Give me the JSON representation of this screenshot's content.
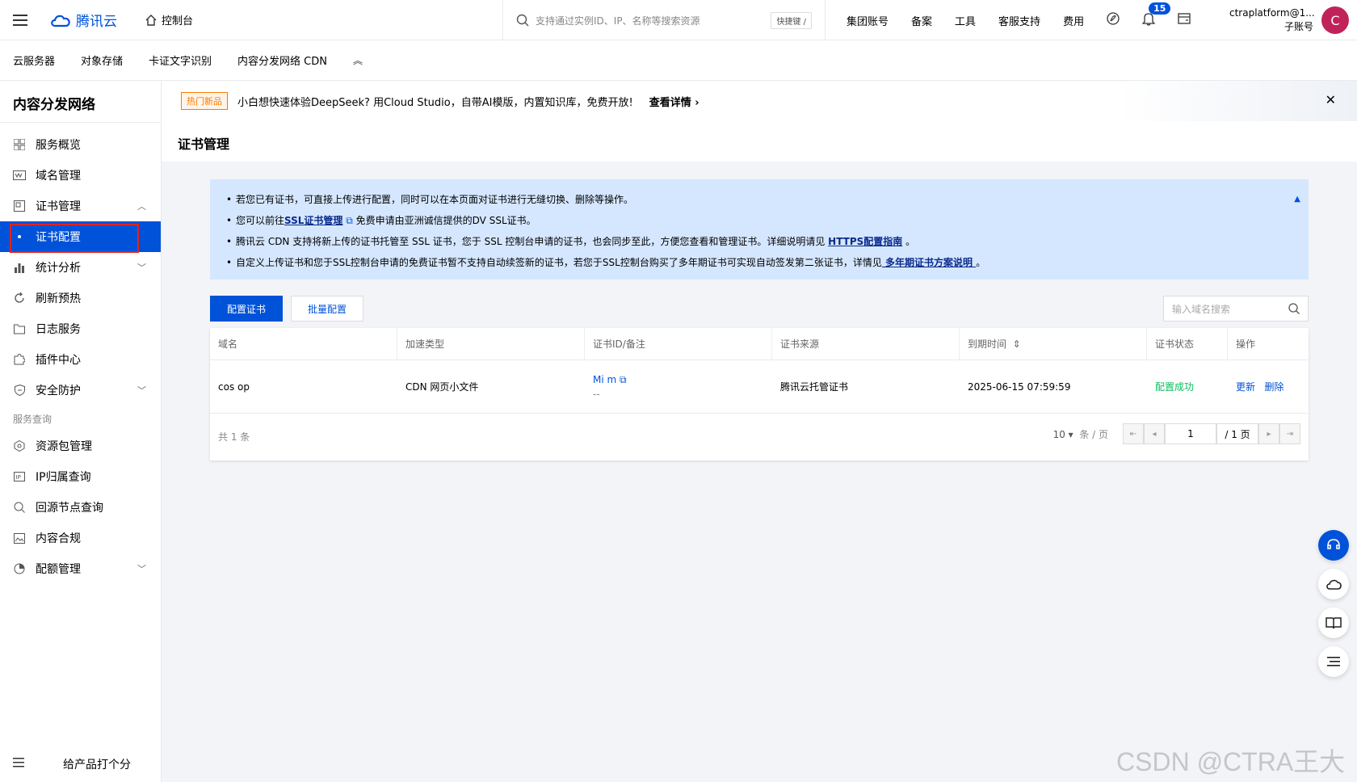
{
  "topbar": {
    "logo_text": "腾讯云",
    "console_label": "控制台",
    "search_placeholder": "支持通过实例ID、IP、名称等搜索资源",
    "shortcut": "快捷键 /",
    "links": [
      "集团账号",
      "备案",
      "工具",
      "客服支持",
      "费用"
    ],
    "notification_count": "15",
    "account_name": "ctraplatform@1...",
    "account_type": "子账号",
    "avatar_letter": "C"
  },
  "product_tabs": [
    "云服务器",
    "对象存储",
    "卡证文字识别",
    "内容分发网络 CDN"
  ],
  "sidebar": {
    "title": "内容分发网络",
    "items": [
      {
        "label": "服务概览",
        "icon": "grid-icon"
      },
      {
        "label": "域名管理",
        "icon": "domain-icon"
      },
      {
        "label": "证书管理",
        "icon": "certificate-icon"
      },
      {
        "label": "证书配置",
        "icon": "dot-icon",
        "active": true
      },
      {
        "label": "统计分析",
        "icon": "bar-chart-icon"
      },
      {
        "label": "刷新预热",
        "icon": "refresh-icon"
      },
      {
        "label": "日志服务",
        "icon": "folder-icon"
      },
      {
        "label": "插件中心",
        "icon": "puzzle-icon"
      },
      {
        "label": "安全防护",
        "icon": "shield-icon"
      }
    ],
    "group_label": "服务查询",
    "items2": [
      {
        "label": "资源包管理",
        "icon": "package-icon"
      },
      {
        "label": "IP归属查询",
        "icon": "ip-icon"
      },
      {
        "label": "回源节点查询",
        "icon": "node-search-icon"
      },
      {
        "label": "内容合规",
        "icon": "image-icon"
      },
      {
        "label": "配额管理",
        "icon": "pie-icon"
      }
    ],
    "rate_label": "给产品打个分"
  },
  "promo": {
    "tag": "热门新品",
    "text": "小白想快速体验DeepSeek? 用Cloud Studio，自带AI模版，内置知识库，免费开放!",
    "link": "查看详情"
  },
  "page_title": "证书管理",
  "notice": {
    "line1": "若您已有证书，可直接上传进行配置，同时可以在本页面对证书进行无缝切换、删除等操作。",
    "line2_pre": "您可以前往",
    "line2_link": "SSL证书管理",
    "line2_post": "免费申请由亚洲诚信提供的DV SSL证书。",
    "line3_pre": "腾讯云 CDN 支持将新上传的证书托管至 SSL 证书，您于 SSL 控制台申请的证书，也会同步至此，方便您查看和管理证书。详细说明请见 ",
    "line3_link": "HTTPS配置指南",
    "line3_post": " 。",
    "line4_pre": "自定义上传证书和您于SSL控制台申请的免费证书暂不支持自动续签新的证书，若您于SSL控制台购买了多年期证书可实现自动签发第二张证书，详情见",
    "line4_link": " 多年期证书方案说明 ",
    "line4_post": "。"
  },
  "buttons": {
    "configure": "配置证书",
    "batch": "批量配置"
  },
  "domain_search_placeholder": "输入域名搜索",
  "table": {
    "headers": [
      "域名",
      "加速类型",
      "证书ID/备注",
      "证书来源",
      "到期时间",
      "证书状态",
      "操作"
    ],
    "rows": [
      {
        "domain": "cos          op",
        "type": "CDN 网页小文件",
        "cert_id": "Mi          m",
        "cert_note": "--",
        "source": "腾讯云托管证书",
        "expiry": "2025-06-15 07:59:59",
        "status": "配置成功",
        "action_update": "更新",
        "action_delete": "删除"
      }
    ],
    "total": "共 1 条",
    "page_size": "10",
    "page_size_unit": "条 / 页",
    "current_page": "1",
    "total_pages": "/ 1 页"
  },
  "watermark": "CSDN @CTRA王大大",
  "colors": {
    "brand": "#0052d9",
    "success": "#0abf5b",
    "highlight_border": "#e0241b"
  }
}
